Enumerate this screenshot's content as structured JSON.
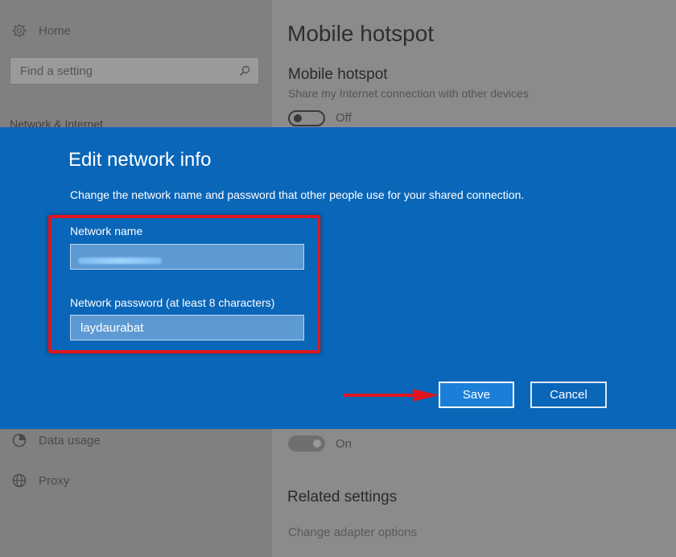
{
  "sidebar": {
    "home_label": "Home",
    "search_placeholder": "Find a setting",
    "section_label": "Network & Internet",
    "items": [
      {
        "label": "Data usage",
        "icon": "data-usage-icon"
      },
      {
        "label": "Proxy",
        "icon": "globe-icon"
      }
    ]
  },
  "main": {
    "page_title": "Mobile hotspot",
    "section_title": "Mobile hotspot",
    "section_desc": "Share my Internet connection with other devices",
    "hotspot_toggle_state": "Off",
    "remote_toggle_state": "On",
    "related_title": "Related settings",
    "related_link": "Change adapter options"
  },
  "dialog": {
    "title": "Edit network info",
    "description": "Change the network name and password that other people use for your shared connection.",
    "network_name_label": "Network name",
    "network_name_value": "",
    "password_label": "Network password (at least 8 characters)",
    "password_value": "laydaurabat",
    "save_label": "Save",
    "cancel_label": "Cancel"
  },
  "colors": {
    "dialog_bg": "#0a66b8",
    "highlight": "#e0141e",
    "arrow": "#e0141e",
    "overlay_gray": "#8a8a8a"
  }
}
